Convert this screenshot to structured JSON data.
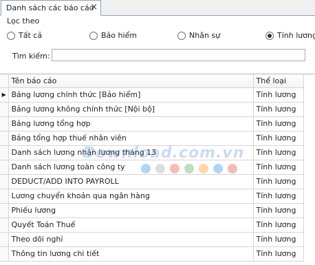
{
  "tab": {
    "title": "Danh sách các báo cáo",
    "close": "×"
  },
  "filter": {
    "title": "Lọc theo",
    "options": [
      {
        "label": "Tất cả",
        "checked": false
      },
      {
        "label": "Bảo hiểm",
        "checked": false
      },
      {
        "label": "Nhân sự",
        "checked": false
      },
      {
        "label": "Tính lương",
        "checked": true
      }
    ],
    "search_label": "Tìm kiếm:",
    "search_value": ""
  },
  "grid": {
    "columns": [
      "Tên báo cáo",
      "Thể loại"
    ],
    "current_row_marker": "▶",
    "rows": [
      {
        "name": "Bảng lương chính thức [Bảo hiểm]",
        "category": "Tính lương"
      },
      {
        "name": "Bảng lương không chính thức [Nội bộ]",
        "category": "Tính lương"
      },
      {
        "name": "Bảng lương tổng hợp",
        "category": "Tính lương"
      },
      {
        "name": "Bảng tổng hợp thuế nhân viên",
        "category": "Tính lương"
      },
      {
        "name": "Danh sách lương nhận lương tháng 13",
        "category": "Tính lương"
      },
      {
        "name": "Danh sách lương toàn công ty",
        "category": "Tính lương"
      },
      {
        "name": "DEDUCT/ADD INTO PAYROLL",
        "category": "Tính lương"
      },
      {
        "name": "Lương chuyển khoản qua ngân hàng",
        "category": "Tính lương"
      },
      {
        "name": "Phiếu lương",
        "category": "Tính lương"
      },
      {
        "name": "Quyết Toán Thuế",
        "category": "Tính lương"
      },
      {
        "name": "Theo dõi nghỉ",
        "category": "Tính lương"
      },
      {
        "name": "Thông tin  lương chi tiết",
        "category": "Tính lương"
      }
    ]
  },
  "watermark": {
    "text": "Download.com.vn"
  },
  "colors": {
    "border": "#8aa1c1",
    "grid_line": "#d5d5d5",
    "watermark_dots": [
      "#1e88e5",
      "#9e9e9e",
      "#e53935",
      "#43a047",
      "#fb8c00",
      "#1e88e5",
      "#e53935"
    ]
  }
}
